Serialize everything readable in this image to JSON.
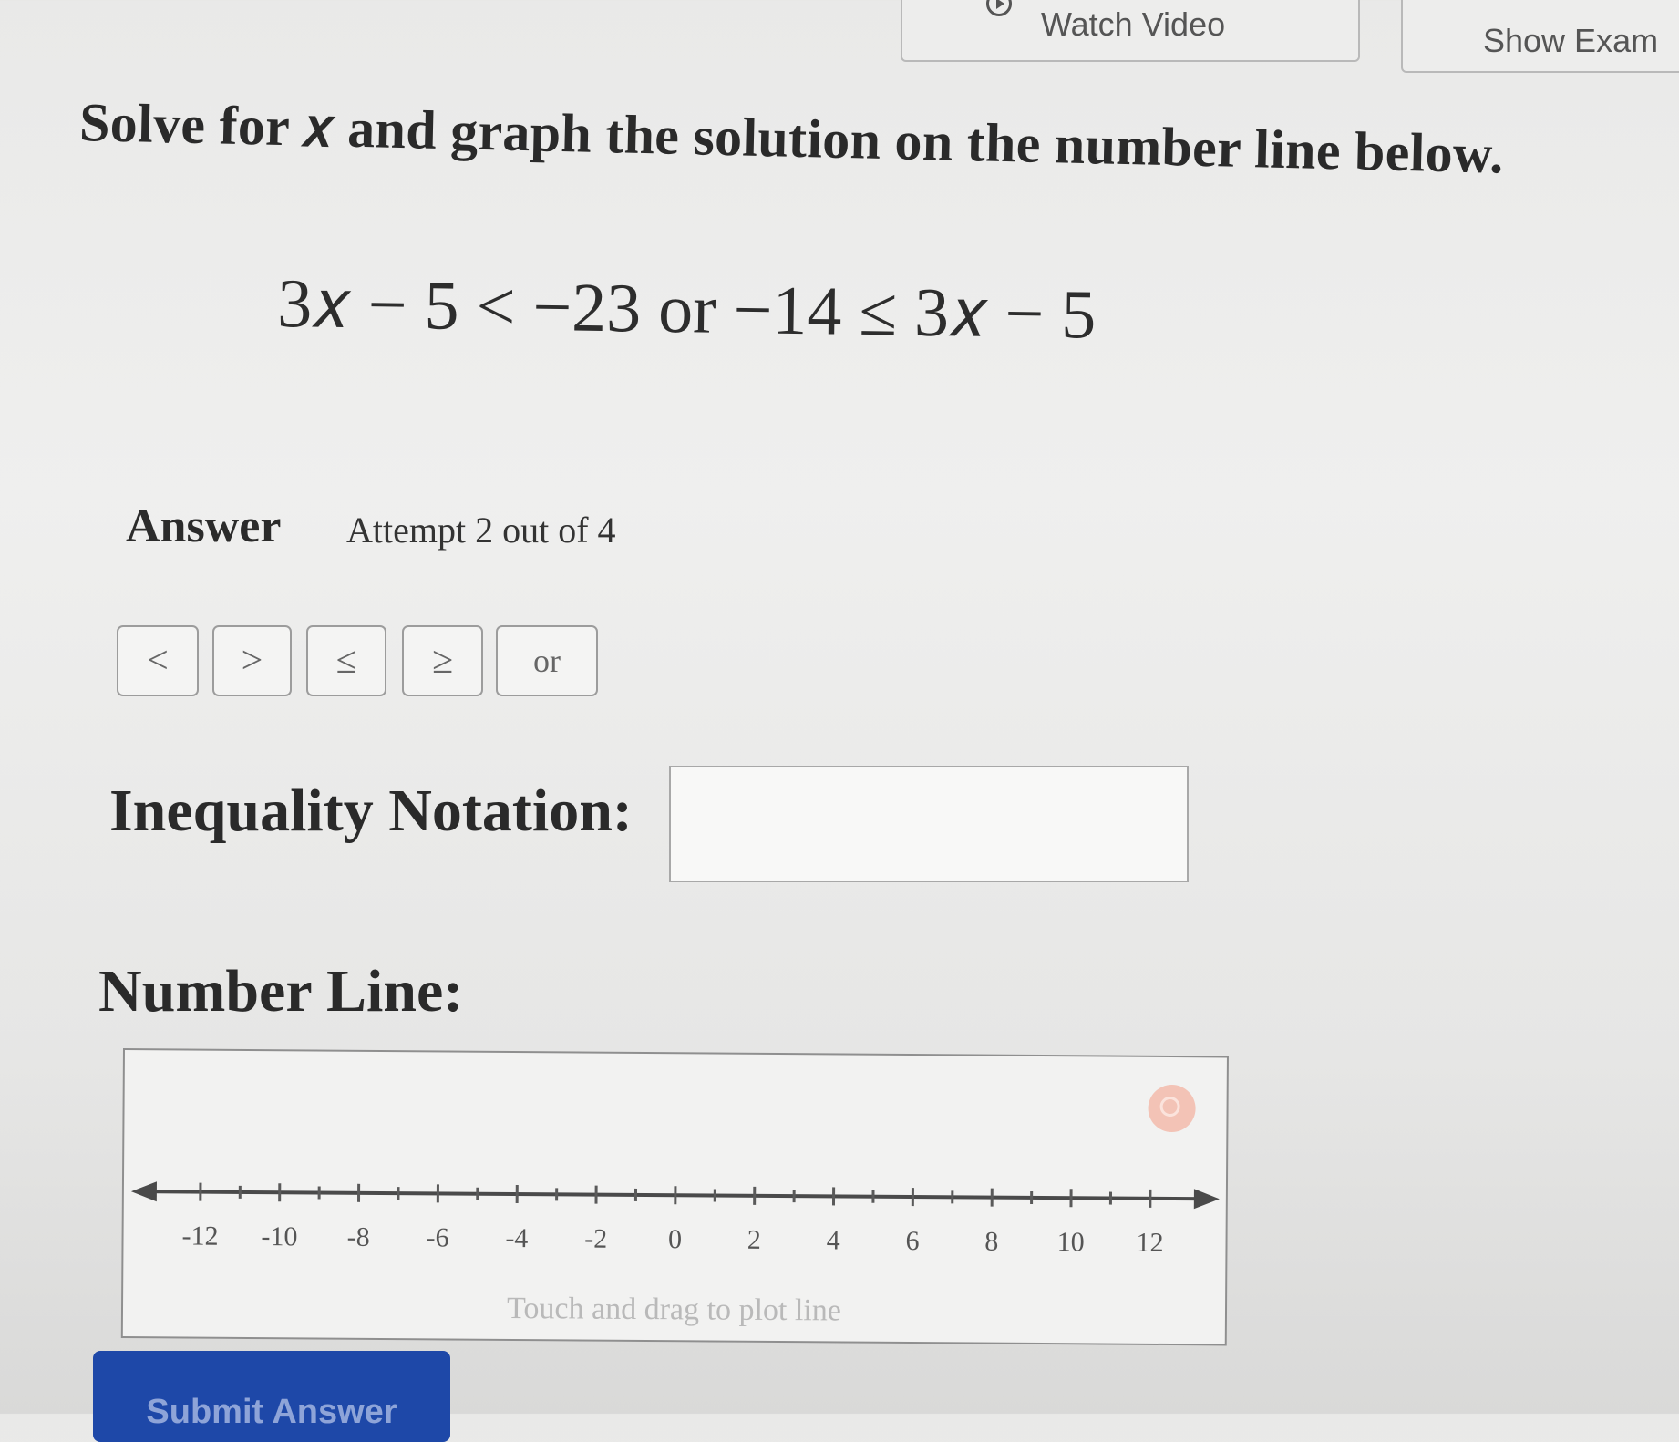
{
  "top_buttons": {
    "watch_video": "Watch Video",
    "show_example": "Show Exam"
  },
  "prompt": "Solve for 𝑥 and graph the solution on the number line below.",
  "equation": "3𝑥 − 5 < −23   or   −14 ≤ 3𝑥 − 5",
  "answer": {
    "title": "Answer",
    "attempt": "Attempt 2 out of 4"
  },
  "symbol_buttons": {
    "lt": "<",
    "gt": ">",
    "le": "≤",
    "ge": "≥",
    "or": "or"
  },
  "inequality": {
    "label": "Inequality Notation:",
    "value": ""
  },
  "number_line": {
    "label": "Number Line:",
    "ticks": [
      "-12",
      "-10",
      "-8",
      "-6",
      "-4",
      "-2",
      "0",
      "2",
      "4",
      "6",
      "8",
      "10",
      "12"
    ],
    "hint": "Touch and drag to plot line"
  },
  "submit": "Submit Answer",
  "colors": {
    "submit_bg": "#1e48a8",
    "clear_icon": "#f3c3b6"
  },
  "icons": {
    "watch": "play-circle-icon",
    "clear": "clear-icon"
  }
}
